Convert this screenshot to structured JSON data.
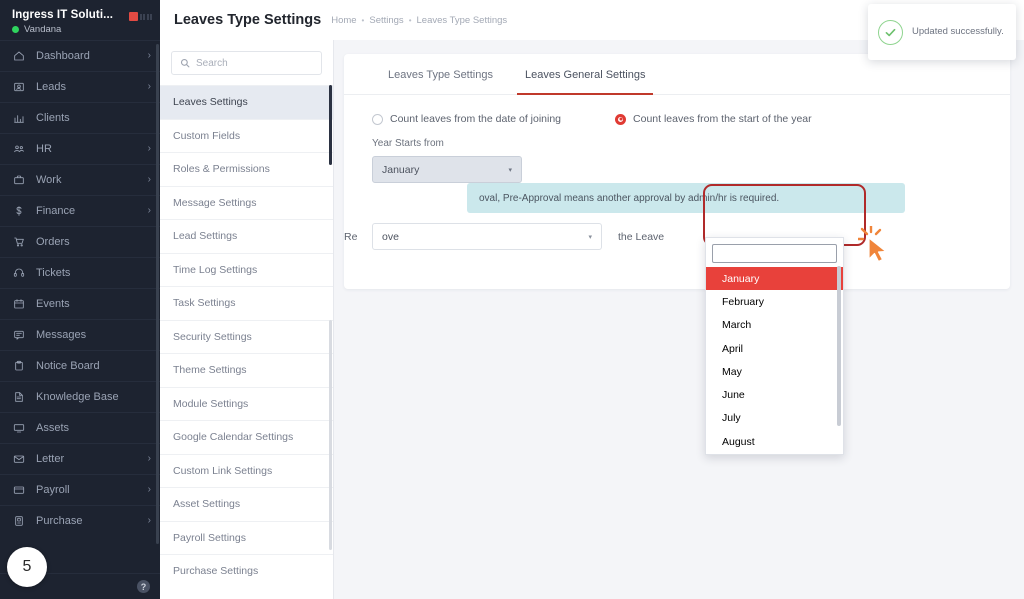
{
  "sidebar": {
    "brand": "Ingress IT Soluti...",
    "user": "Vandana",
    "items": [
      {
        "label": "Dashboard",
        "icon": "home-icon",
        "chevron": "›"
      },
      {
        "label": "Leads",
        "icon": "leads-icon",
        "chevron": "›"
      },
      {
        "label": "Clients",
        "icon": "clients-icon",
        "chevron": ""
      },
      {
        "label": "HR",
        "icon": "people-icon",
        "chevron": "›"
      },
      {
        "label": "Work",
        "icon": "briefcase-icon",
        "chevron": "›"
      },
      {
        "label": "Finance",
        "icon": "dollar-icon",
        "chevron": "›"
      },
      {
        "label": "Orders",
        "icon": "cart-icon",
        "chevron": ""
      },
      {
        "label": "Tickets",
        "icon": "headset-icon",
        "chevron": ""
      },
      {
        "label": "Events",
        "icon": "calendar-icon",
        "chevron": ""
      },
      {
        "label": "Messages",
        "icon": "message-icon",
        "chevron": ""
      },
      {
        "label": "Notice Board",
        "icon": "clipboard-icon",
        "chevron": ""
      },
      {
        "label": "Knowledge Base",
        "icon": "document-icon",
        "chevron": ""
      },
      {
        "label": "Assets",
        "icon": "monitor-icon",
        "chevron": ""
      },
      {
        "label": "Letter",
        "icon": "envelope-icon",
        "chevron": "›"
      },
      {
        "label": "Payroll",
        "icon": "wallet-icon",
        "chevron": "›"
      },
      {
        "label": "Purchase",
        "icon": "purchase-icon",
        "chevron": "›"
      }
    ],
    "bottom_label": "",
    "step_number": "5"
  },
  "topbar": {
    "title": "Leaves Type Settings",
    "breadcrumb": [
      "Home",
      "Settings",
      "Leaves Type Settings"
    ],
    "separator": "•",
    "search_icon": "search-icon"
  },
  "toast": {
    "message": "Updated successfully.",
    "icon": "check-circle-icon",
    "accent": "#7dc87d"
  },
  "settings_panel": {
    "search_placeholder": "Search",
    "search_value": "",
    "items": [
      "Leaves Settings",
      "Custom Fields",
      "Roles & Permissions",
      "Message Settings",
      "Lead Settings",
      "Time Log Settings",
      "Task Settings",
      "Security Settings",
      "Theme Settings",
      "Module Settings",
      "Google Calendar Settings",
      "Custom Link Settings",
      "Asset Settings",
      "Payroll Settings",
      "Purchase Settings"
    ],
    "active_index": 0
  },
  "main": {
    "tabs": [
      {
        "label": "Leaves Type Settings",
        "active": false
      },
      {
        "label": "Leaves General Settings",
        "active": true
      }
    ],
    "radio_options": [
      {
        "label": "Count leaves from the date of joining",
        "selected": false
      },
      {
        "label": "Count leaves from the start of the year",
        "selected": true
      }
    ],
    "year_starts_from": {
      "label": "Year Starts from",
      "value": "January",
      "caret": "▾"
    },
    "info_banner": "oval, Pre-Approval means another approval by admin/hr is required.",
    "approval_row": {
      "prefix": "Re",
      "select_value": "ove",
      "caret": "▾",
      "suffix": "the Leave"
    },
    "highlight_color": "#b02a2a",
    "accent_color": "#c0392b"
  },
  "dropdown": {
    "search_value": "",
    "options": [
      "January",
      "February",
      "March",
      "April",
      "May",
      "June",
      "July",
      "August"
    ],
    "selected": "January",
    "selected_bg": "#e8413b"
  },
  "cursor": {
    "icon": "click-cursor-icon",
    "color": "#f0853a"
  }
}
